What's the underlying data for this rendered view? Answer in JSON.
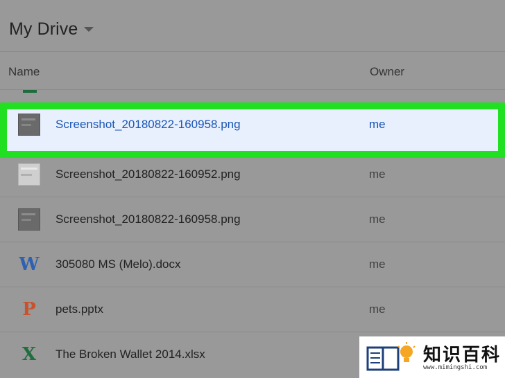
{
  "header": {
    "title": "My Drive"
  },
  "columns": {
    "name": "Name",
    "owner": "Owner"
  },
  "files": [
    {
      "name": "Screenshot_20180822-160958.png",
      "owner": "me",
      "icon": "image-thumbnail-dark",
      "selected": true
    },
    {
      "name": "Screenshot_20180822-160952.png",
      "owner": "me",
      "icon": "image-thumbnail-light",
      "selected": false
    },
    {
      "name": "Screenshot_20180822-160958.png",
      "owner": "me",
      "icon": "image-thumbnail-dark",
      "selected": false
    },
    {
      "name": "305080 MS (Melo).docx",
      "owner": "me",
      "icon": "word-icon",
      "selected": false
    },
    {
      "name": "pets.pptx",
      "owner": "me",
      "icon": "powerpoint-icon",
      "selected": false
    },
    {
      "name": "The Broken Wallet 2014.xlsx",
      "owner": "",
      "icon": "excel-icon",
      "selected": false
    }
  ],
  "icon_glyphs": {
    "word": "W",
    "powerpoint": "P",
    "excel": "X"
  },
  "watermark": {
    "title": "知识百科",
    "url": "www.mimingshi.com"
  },
  "colors": {
    "highlight_border": "#21e021",
    "selected_bg": "#e8f0fe",
    "selected_text": "#1a56b5",
    "word": "#2f61b3",
    "powerpoint": "#c8522c",
    "excel": "#1f6e3d"
  }
}
